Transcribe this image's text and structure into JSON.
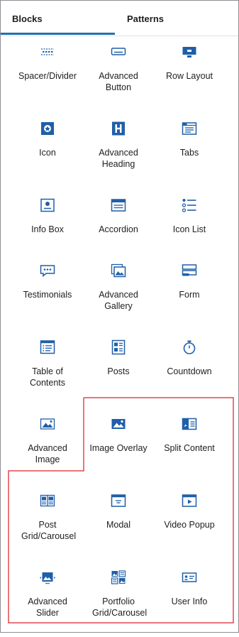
{
  "tabs": [
    {
      "label": "Blocks",
      "active": true
    },
    {
      "label": "Patterns",
      "active": false
    }
  ],
  "accent_color": "#2271b1",
  "icon_color": "#1f5fa8",
  "highlight_color": "#e0484f",
  "blocks": [
    {
      "label": "Spacer/Divider",
      "icon": "spacer-divider-icon"
    },
    {
      "label": "Advanced Button",
      "icon": "advanced-button-icon"
    },
    {
      "label": "Row Layout",
      "icon": "row-layout-icon"
    },
    {
      "label": "Icon",
      "icon": "icon-block-icon"
    },
    {
      "label": "Advanced Heading",
      "icon": "advanced-heading-icon"
    },
    {
      "label": "Tabs",
      "icon": "tabs-icon"
    },
    {
      "label": "Info Box",
      "icon": "info-box-icon"
    },
    {
      "label": "Accordion",
      "icon": "accordion-icon"
    },
    {
      "label": "Icon List",
      "icon": "icon-list-icon"
    },
    {
      "label": "Testimonials",
      "icon": "testimonials-icon"
    },
    {
      "label": "Advanced Gallery",
      "icon": "advanced-gallery-icon"
    },
    {
      "label": "Form",
      "icon": "form-icon"
    },
    {
      "label": "Table of Contents",
      "icon": "table-of-contents-icon"
    },
    {
      "label": "Posts",
      "icon": "posts-icon"
    },
    {
      "label": "Countdown",
      "icon": "countdown-icon"
    },
    {
      "label": "Advanced Image",
      "icon": "advanced-image-icon"
    },
    {
      "label": "Image Overlay",
      "icon": "image-overlay-icon"
    },
    {
      "label": "Split Content",
      "icon": "split-content-icon"
    },
    {
      "label": "Post Grid/Carousel",
      "icon": "post-grid-icon"
    },
    {
      "label": "Modal",
      "icon": "modal-icon"
    },
    {
      "label": "Video Popup",
      "icon": "video-popup-icon"
    },
    {
      "label": "Advanced Slider",
      "icon": "advanced-slider-icon"
    },
    {
      "label": "Portfolio Grid/Carousel",
      "icon": "portfolio-grid-icon"
    },
    {
      "label": "User Info",
      "icon": "user-info-icon"
    }
  ]
}
